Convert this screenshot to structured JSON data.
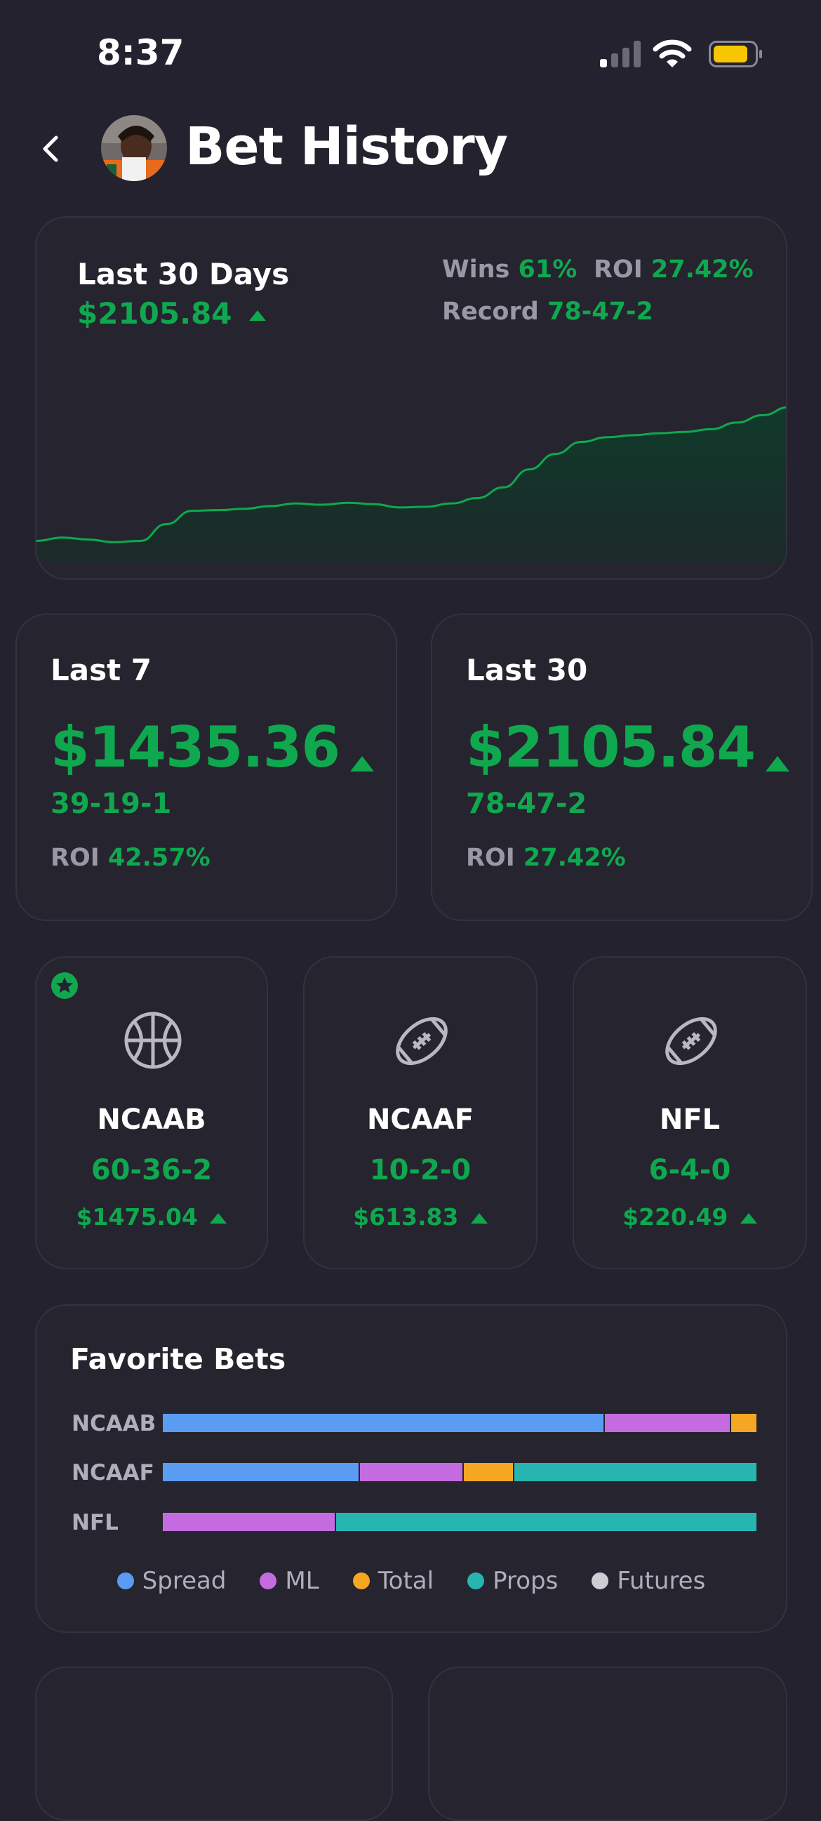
{
  "status": {
    "time": "8:37"
  },
  "header": {
    "title": "Bet History"
  },
  "summary": {
    "period_label": "Last 30 Days",
    "amount": "$2105.84",
    "wins_label": "Wins",
    "wins_value": "61%",
    "roi_label": "ROI",
    "roi_value": "27.42%",
    "record_label": "Record",
    "record_value": "78-47-2"
  },
  "chart_data": {
    "type": "area",
    "x": [
      1,
      2,
      3,
      4,
      5,
      6,
      7,
      8,
      9,
      10,
      11,
      12,
      13,
      14,
      15,
      16,
      17,
      18,
      19,
      20,
      21,
      22,
      23,
      24,
      25,
      26,
      27,
      28,
      29,
      30
    ],
    "series": [
      {
        "values": [
          10,
          15,
          12,
          8,
          10,
          35,
          55,
          56,
          58,
          62,
          66,
          64,
          67,
          65,
          60,
          61,
          66,
          74,
          90,
          117,
          140,
          158,
          165,
          168,
          171,
          173,
          177,
          187,
          198,
          210
        ]
      }
    ]
  },
  "periods": [
    {
      "label": "Last 7",
      "amount": "$1435.36",
      "record": "39-19-1",
      "roi_label": "ROI",
      "roi_value": "42.57%"
    },
    {
      "label": "Last 30",
      "amount": "$2105.84",
      "record": "78-47-2",
      "roi_label": "ROI",
      "roi_value": "27.42%"
    }
  ],
  "sports": [
    {
      "name": "NCAAB",
      "record": "60-36-2",
      "amount": "$1475.04",
      "icon": "basketball-icon",
      "favorite": true
    },
    {
      "name": "NCAAF",
      "record": "10-2-0",
      "amount": "$613.83",
      "icon": "football-icon",
      "favorite": false
    },
    {
      "name": "NFL",
      "record": "6-4-0",
      "amount": "$220.49",
      "icon": "football-icon",
      "favorite": false
    }
  ],
  "favorite_bets": {
    "title": "Favorite Bets",
    "rows": [
      {
        "label": "NCAAB",
        "segments": [
          {
            "type": "Spread",
            "share": 0.745
          },
          {
            "type": "ML",
            "share": 0.212
          },
          {
            "type": "Total",
            "share": 0.043
          }
        ]
      },
      {
        "label": "NCAAF",
        "segments": [
          {
            "type": "Spread",
            "share": 0.332
          },
          {
            "type": "ML",
            "share": 0.175
          },
          {
            "type": "Total",
            "share": 0.085
          },
          {
            "type": "Props",
            "share": 0.408
          }
        ]
      },
      {
        "label": "NFL",
        "segments": [
          {
            "type": "ML",
            "share": 0.292
          },
          {
            "type": "Props",
            "share": 0.708
          }
        ]
      }
    ],
    "legend": [
      {
        "label": "Spread",
        "color": "#5a9cf2"
      },
      {
        "label": "ML",
        "color": "#c56be0"
      },
      {
        "label": "Total",
        "color": "#f5a623"
      },
      {
        "label": "Props",
        "color": "#26b5b0"
      },
      {
        "label": "Futures",
        "color": "#cfcdd4"
      }
    ]
  },
  "colors": {
    "accent": "#0fa84f",
    "background": "#24222f",
    "card": "#26242f"
  }
}
